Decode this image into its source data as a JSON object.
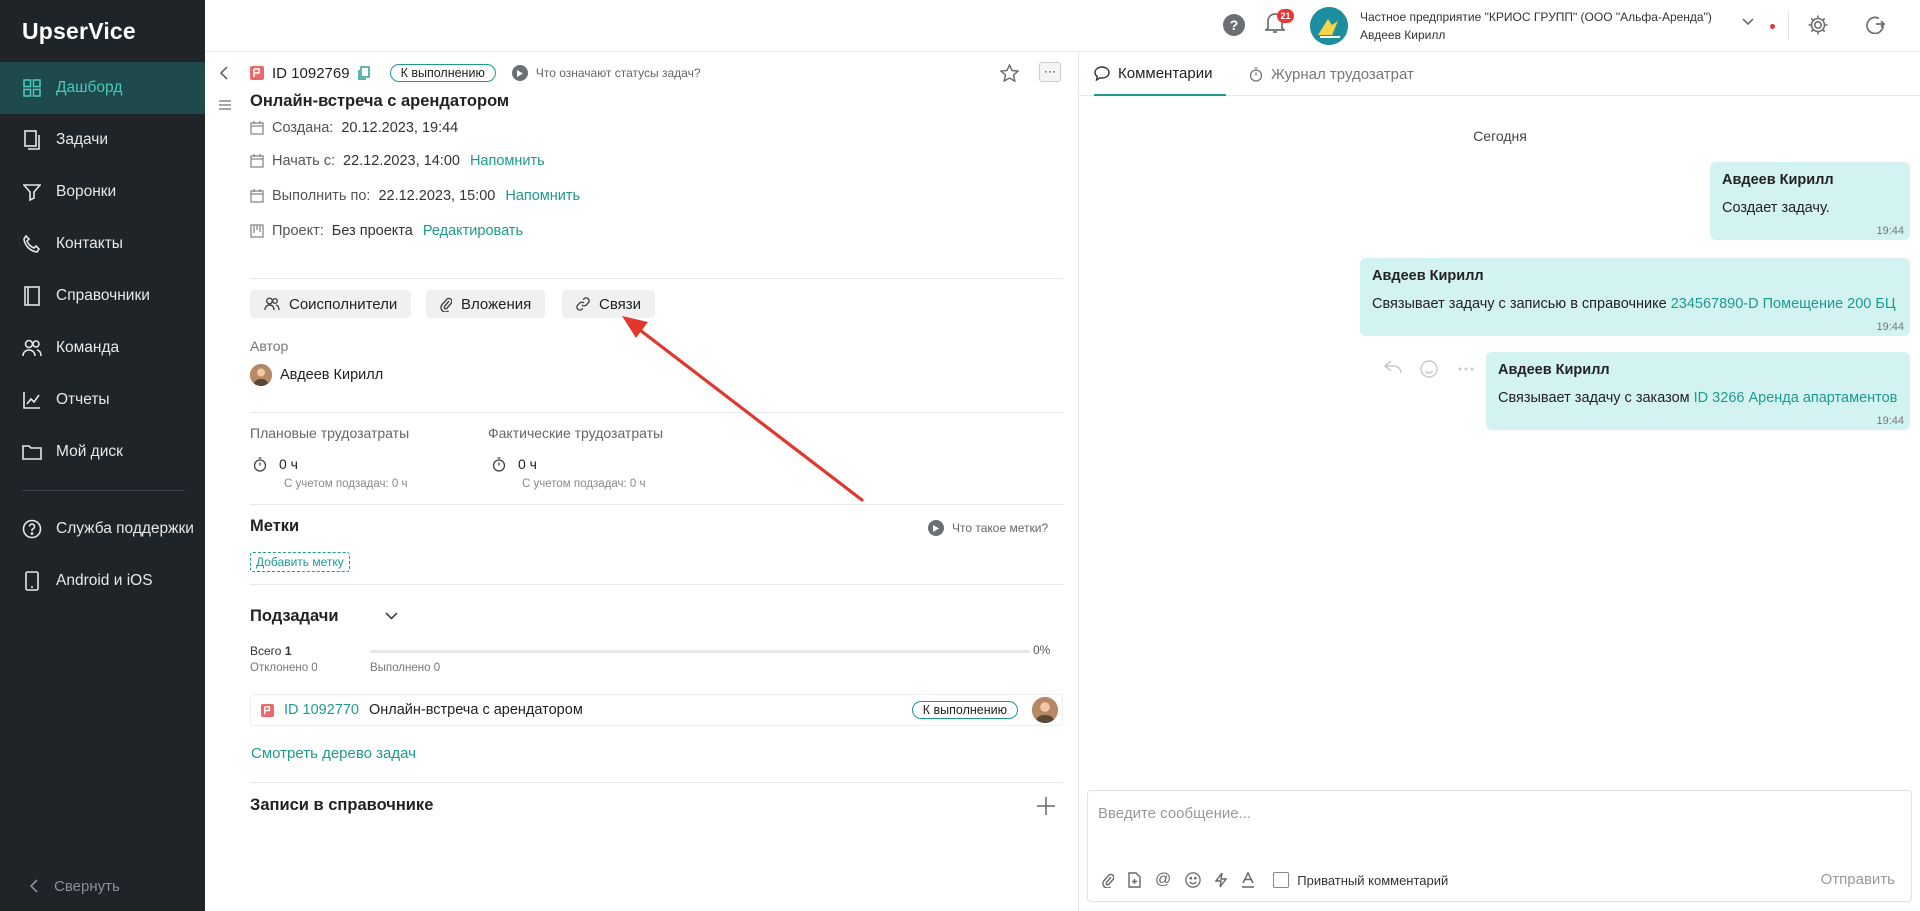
{
  "app": {
    "logo": "UpserVice"
  },
  "sidebar": {
    "items": [
      {
        "label": "Дашборд",
        "icon": "dashboard-icon"
      },
      {
        "label": "Задачи",
        "icon": "tasks-icon"
      },
      {
        "label": "Воронки",
        "icon": "funnel-icon"
      },
      {
        "label": "Контакты",
        "icon": "contacts-icon"
      },
      {
        "label": "Справочники",
        "icon": "book-icon"
      },
      {
        "label": "Команда",
        "icon": "team-icon"
      },
      {
        "label": "Отчеты",
        "icon": "chart-icon"
      },
      {
        "label": "Мой диск",
        "icon": "folder-icon"
      }
    ],
    "extra": [
      {
        "label": "Служба поддержки",
        "icon": "help-icon"
      },
      {
        "label": "Android и iOS",
        "icon": "mobile-icon"
      }
    ],
    "collapse_label": "Свернуть"
  },
  "topbar": {
    "notifications_count": "21",
    "org_name": "Частное предприятие \"КРИОС ГРУПП\" (ООО \"Альфа-Аренда\")",
    "user_name": "Авдеев Кирилл"
  },
  "task": {
    "id": "ID 1092769",
    "status": "К выполнению",
    "status_hint": "Что означают статусы задач?",
    "title": "Онлайн-встреча с арендатором",
    "created_label": "Создана:",
    "created_value": "20.12.2023, 19:44",
    "start_label": "Начать с:",
    "start_value": "22.12.2023, 14:00",
    "due_label": "Выполнить по:",
    "due_value": "22.12.2023, 15:00",
    "remind_label": "Напомнить",
    "project_label": "Проект:",
    "project_value": "Без проекта",
    "edit_label": "Редактировать",
    "chips": {
      "coexecutors": "Соисполнители",
      "attachments": "Вложения",
      "links": "Связи"
    },
    "author_label": "Автор",
    "author_name": "Авдеев Кирилл",
    "planned_label": "Плановые трудозатраты",
    "planned_value": "0 ч",
    "planned_sub": "С учетом подзадач: 0 ч",
    "actual_label": "Фактические трудозатраты",
    "actual_value": "0 ч",
    "actual_sub": "С учетом подзадач: 0 ч",
    "tags_title": "Метки",
    "tags_hint": "Что такое метки?",
    "add_tag": "Добавить метку",
    "subtasks_title": "Подзадачи",
    "total_label": "Всего",
    "total_value": "1",
    "rejected": "Отклонено 0",
    "done": "Выполнено 0",
    "progress_percent": "0%",
    "progress_value": 0,
    "subtask": {
      "id": "ID 1092770",
      "title": "Онлайн-встреча с арендатором",
      "status": "К выполнению"
    },
    "tree_link": "Смотреть дерево задач",
    "records_title": "Записи в справочнике"
  },
  "comments": {
    "tabs": {
      "comments": "Комментарии",
      "worklog": "Журнал трудозатрат"
    },
    "day": "Сегодня",
    "messages": [
      {
        "author": "Авдеев Кирилл",
        "text": "Создает задачу.",
        "link": "",
        "time": "19:44"
      },
      {
        "author": "Авдеев Кирилл",
        "text": "Связывает задачу с записью в справочнике ",
        "link": "234567890-D Помещение 200 БЦ",
        "time": "19:44"
      },
      {
        "author": "Авдеев Кирилл",
        "text": "Связывает задачу с заказом ",
        "link": "ID 3266 Аренда апартаментов",
        "time": "19:44"
      }
    ],
    "composer_placeholder": "Введите сообщение...",
    "private_label": "Приватный комментарий",
    "send_label": "Отправить"
  },
  "colors": {
    "accent": "#1e9a8e",
    "sidebar_bg": "#1f2428",
    "sidebar_active": "#1e4a4b",
    "bubble": "#d3f3f2",
    "arrow": "#e0372f",
    "task_icon": "#e86a6a"
  }
}
